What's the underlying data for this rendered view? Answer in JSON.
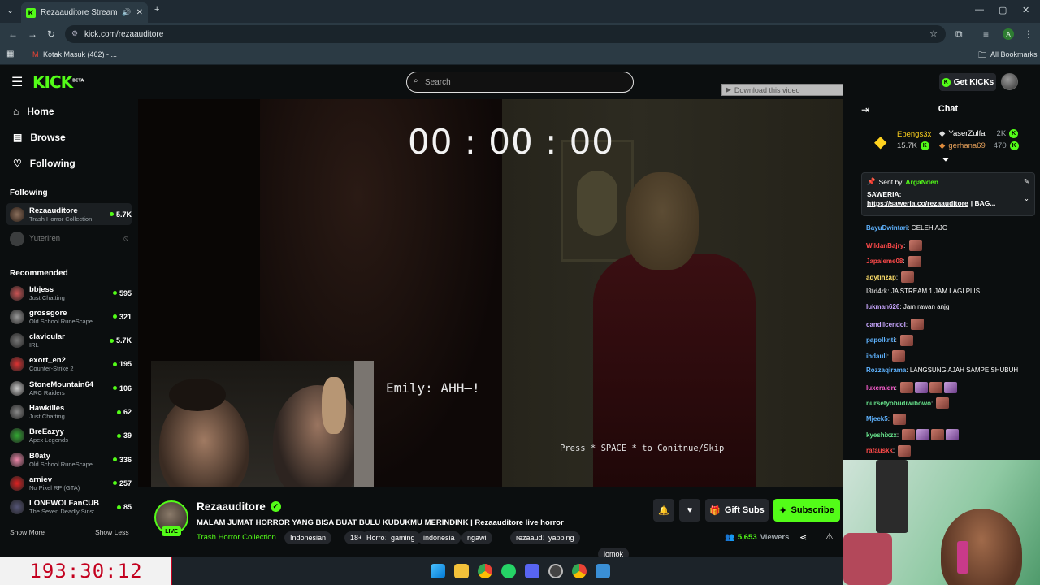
{
  "browser": {
    "tab_title": "Rezaauditore Stream - Watch",
    "url": "kick.com/rezaauditore",
    "bookmark_gmail": "Kotak Masuk (462) - ...",
    "all_bookmarks": "All Bookmarks",
    "profile_initial": "A"
  },
  "header": {
    "logo": "KICK",
    "logo_beta": "BETA",
    "search_placeholder": "Search",
    "get_kicks": "Get KICKs"
  },
  "sidebar": {
    "nav": [
      "Home",
      "Browse",
      "Following"
    ],
    "following_header": "Following",
    "following": [
      {
        "name": "Rezaauditore",
        "category": "Trash Horror Collection",
        "viewers": "5.7K"
      },
      {
        "name": "Yuteriren",
        "category": "",
        "viewers": ""
      }
    ],
    "recommended_header": "Recommended",
    "recommended": [
      {
        "name": "bbjess",
        "category": "Just Chatting",
        "viewers": "595"
      },
      {
        "name": "grossgore",
        "category": "Old School RuneScape",
        "viewers": "321"
      },
      {
        "name": "clavicular",
        "category": "IRL",
        "viewers": "5.7K"
      },
      {
        "name": "exort_en2",
        "category": "Counter-Strike 2",
        "viewers": "195"
      },
      {
        "name": "StoneMountain64",
        "category": "ARC Raiders",
        "viewers": "106"
      },
      {
        "name": "Hawkilles",
        "category": "Just Chatting",
        "viewers": "62"
      },
      {
        "name": "BreEazyy",
        "category": "Apex Legends",
        "viewers": "39"
      },
      {
        "name": "B0aty",
        "category": "Old School RuneScape",
        "viewers": "336"
      },
      {
        "name": "arniev",
        "category": "No Pixel RP (GTA)",
        "viewers": "257"
      },
      {
        "name": "LONEWOLFanCUB",
        "category": "The Seven Deadly Sins:...",
        "viewers": "85"
      }
    ],
    "show_more": "Show More",
    "show_less": "Show Less"
  },
  "video": {
    "timer": "00 : 00 : 00",
    "dialogue": "Emily: AHH—!",
    "press_hint": "Press * SPACE * to Conitnue/Skip",
    "download_label": "Download this video"
  },
  "chat": {
    "title": "Chat",
    "top_gifters": [
      {
        "name": "Epengs3x",
        "amount": "15.7K"
      },
      {
        "name": "YaserZulfa",
        "amount": "2K"
      },
      {
        "name": "gerhana69",
        "amount": "470"
      }
    ],
    "pinned": {
      "sent_by_label": "Sent by",
      "sent_by": "ArgaNden",
      "heading": "SAWERIA:",
      "link": "https://saweria.co/rezaauditore",
      "suffix": "| BAG..."
    },
    "messages": [
      {
        "user": "BayuDwintari",
        "text": "GELEH AJG",
        "color": "#5fb3ff",
        "emotes": 0
      },
      {
        "user": "WildanBajry",
        "text": "",
        "color": "#ff4a4a",
        "emotes": 1
      },
      {
        "user": "Japaleme08",
        "text": "",
        "color": "#ff4a4a",
        "emotes": 1
      },
      {
        "user": "adytihzap",
        "text": "",
        "color": "#ffe06b",
        "emotes": 1
      },
      {
        "user": "l3td4rk",
        "text": "JA STREAM 1 JAM LAGI PLIS",
        "color": "#bdbdbd",
        "emotes": 0
      },
      {
        "user": "lukman626",
        "text": "Jam rawan anjg",
        "color": "#c9a7ff",
        "emotes": 0
      },
      {
        "user": "candilcendol",
        "text": "",
        "color": "#c9a7ff",
        "emotes": 1
      },
      {
        "user": "papolknti",
        "text": "",
        "color": "#5fb3ff",
        "emotes": 1
      },
      {
        "user": "ihdaull",
        "text": "",
        "color": "#5fb3ff",
        "emotes": 1
      },
      {
        "user": "Rozzaqirama",
        "text": "LANGSUNG AJAH SAMPE SHUBUH",
        "color": "#5fb3ff",
        "emotes": 0
      },
      {
        "user": "luxeraidn",
        "text": "",
        "color": "#ff5fd2",
        "emotes": 4
      },
      {
        "user": "nursetyobudiwibowo",
        "text": "",
        "color": "#66e08a",
        "emotes": 1
      },
      {
        "user": "Mjeek5",
        "text": "",
        "color": "#5fb3ff",
        "emotes": 1
      },
      {
        "user": "kyeshixzx",
        "text": "",
        "color": "#66e08a",
        "emotes": 4
      },
      {
        "user": "rafauskk",
        "text": "",
        "color": "#ff4a4a",
        "emotes": 1
      }
    ]
  },
  "stream": {
    "name": "Rezaauditore",
    "live": "LIVE",
    "title": "MALAM JUMAT HORROR YANG BISA BUAT BULU KUDUKMU MERINDINK | Rezaauditore live horror",
    "category": "Trash Horror Collection",
    "tags": [
      "Indonesian",
      "18+",
      "Horror",
      "gaming",
      "indonesia",
      "ngawi",
      "rezaauditore",
      "yapping",
      "jomok"
    ],
    "gift_subs": "Gift Subs",
    "subscribe": "Subscribe",
    "viewers": "5,653",
    "viewers_label": "Viewers"
  },
  "overlay": {
    "countdown": "193:30:12"
  },
  "colors": {
    "accent": "#53fc18",
    "bg": "#0b0e0f",
    "timer_red": "#c3001e"
  }
}
